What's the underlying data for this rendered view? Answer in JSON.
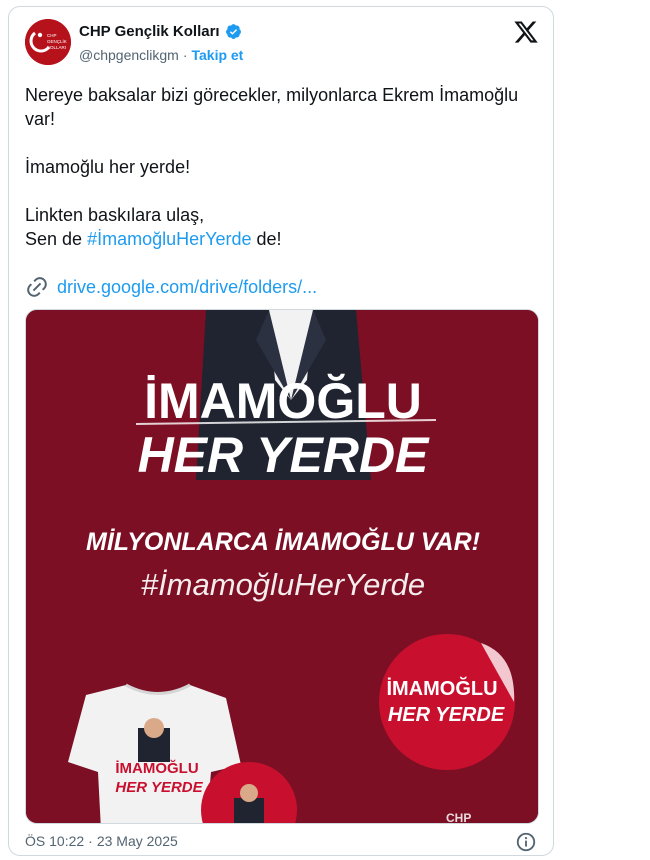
{
  "tweet": {
    "display_name": "CHP Gençlik Kolları",
    "handle": "@chpgenclikgm",
    "separator": "·",
    "follow_label": "Takip et",
    "avatar_text_top": "CHP",
    "avatar_text_mid": "GENÇLİK",
    "avatar_text_bot": "KOLLARI",
    "paragraph_1": "Nereye baksalar bizi görecekler, milyonlarca Ekrem İmamoğlu var!",
    "paragraph_2": "İmamoğlu her yerde!",
    "paragraph_3_line1": "Linkten baskılara ulaş,",
    "paragraph_3_prefix": "Sen de ",
    "hashtag": "#İmamoğluHerYerde",
    "paragraph_3_suffix": " de!",
    "link_text": "drive.google.com/drive/folders/...",
    "time": "ÖS 10:22",
    "date_sep": "·",
    "date": "23 May 2025"
  },
  "media": {
    "headline_1": "İMAMOĞLU",
    "headline_2": "HER YERDE",
    "slogan": "MİLYONLARCA İMAMOĞLU VAR!",
    "hashtag": "#İmamoğluHerYerde",
    "sticker_line1": "İMAMOĞLU",
    "sticker_line2": "HER YERDE",
    "shirt_line1": "İMAMOĞLU",
    "shirt_line2": "HER YERDE",
    "corner_text": "CHP",
    "colors": {
      "background": "#7d0f24",
      "text": "#ffffff",
      "sticker": "#c8102e"
    }
  },
  "icons": {
    "verified": "verified-badge-icon",
    "x_logo": "x-logo-icon",
    "link": "link-icon",
    "info": "info-icon"
  },
  "colors": {
    "accent": "#1d9bf0",
    "muted": "#536471",
    "text": "#0f1419",
    "border": "#cfd9de",
    "avatar": "#b5121b"
  }
}
